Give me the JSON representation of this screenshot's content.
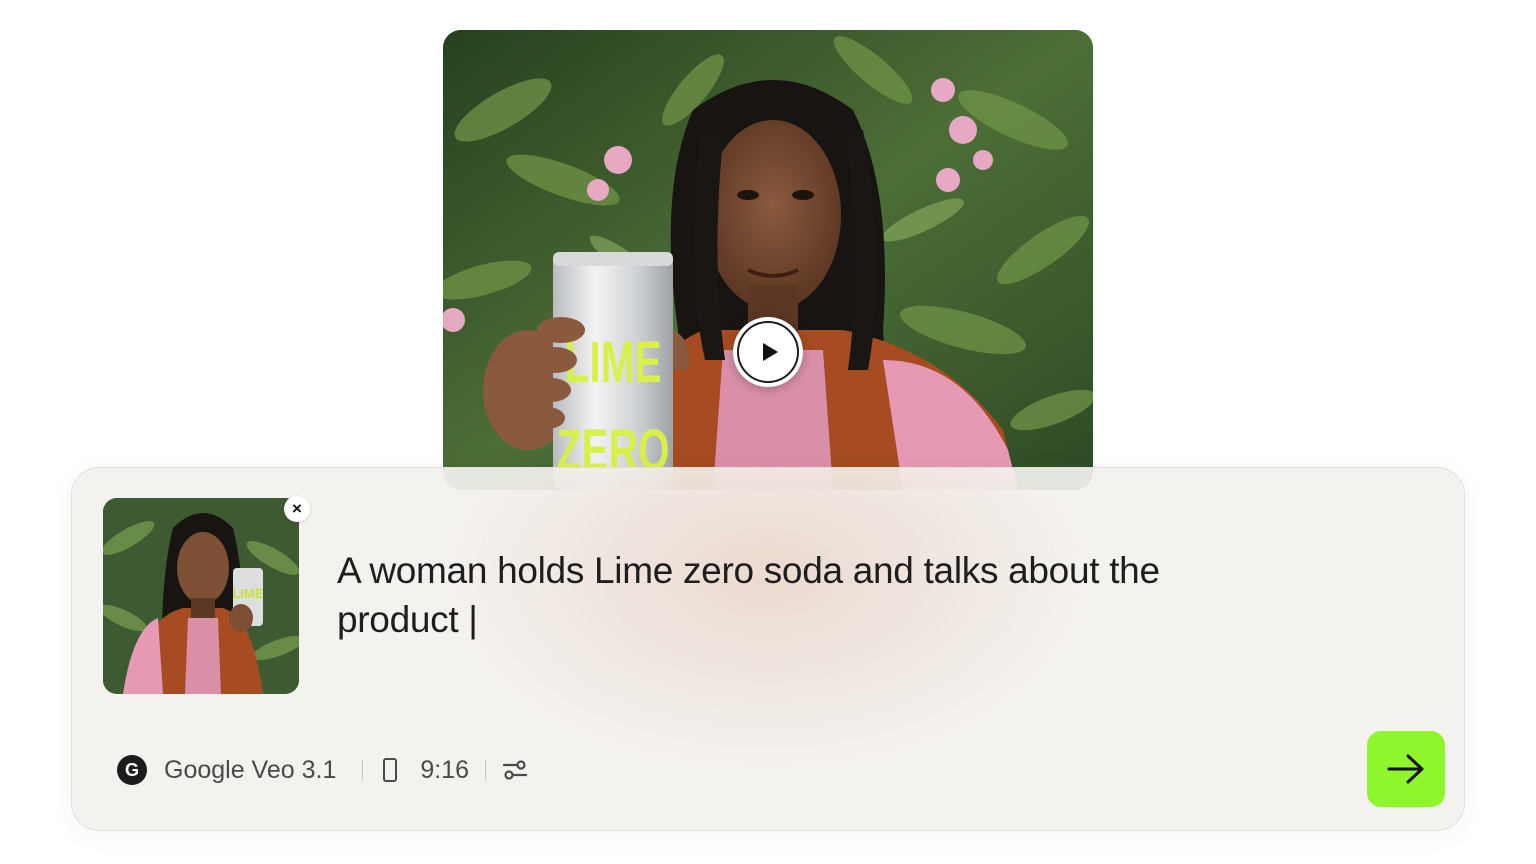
{
  "video": {
    "can_text_line1": "LIME",
    "can_text_line2": "ZERO",
    "play_label": "Play"
  },
  "prompt": {
    "text": "A woman holds Lime zero soda and talks about the product |",
    "close_label": "×"
  },
  "toolbar": {
    "model_logo_letter": "G",
    "model_name": "Google Veo 3.1",
    "aspect_ratio": "9:16"
  },
  "colors": {
    "accent": "#8ef62a",
    "can_text": "#d9f04a",
    "card_bg": "#f3f1ee",
    "text": "#1e1e1e"
  }
}
